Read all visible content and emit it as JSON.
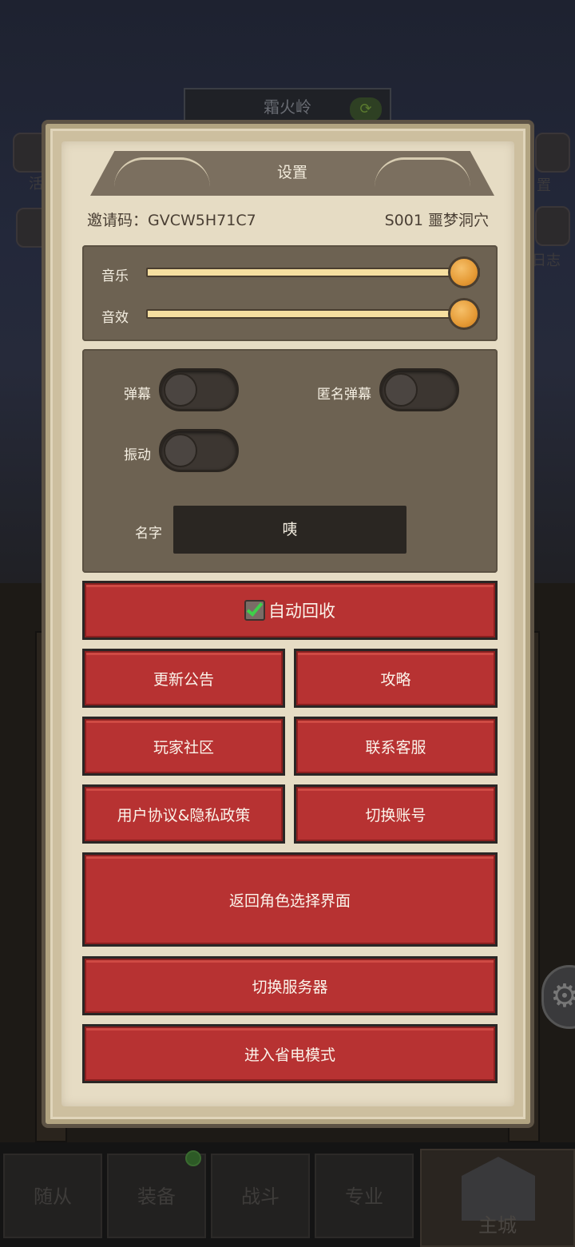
{
  "background": {
    "location_tab": "霜火岭",
    "refresh_icon": "refresh-icon",
    "side_labels": [
      "活",
      "置",
      "日志"
    ]
  },
  "bottom_nav": {
    "tabs": [
      "随从",
      "装备",
      "战斗",
      "专业"
    ],
    "main_tab": "主城"
  },
  "settings": {
    "title": "设置",
    "invite_code_label": "邀请码：",
    "invite_code": "GVCW5H71C7",
    "server": "S001 噩梦洞穴",
    "sliders": {
      "music_label": "音乐",
      "music_level": 1.0,
      "sfx_label": "音效",
      "sfx_level": 1.0
    },
    "toggles": {
      "danmaku_label": "弹幕",
      "danmaku_on": false,
      "anon_danmaku_label": "匿名弹幕",
      "anon_danmaku_on": false,
      "vibration_label": "振动",
      "vibration_on": false
    },
    "name_label": "名字",
    "name_value": "咦",
    "auto_recycle": {
      "label": "自动回收",
      "checked": true
    },
    "buttons": {
      "announcement": "更新公告",
      "guide": "攻略",
      "community": "玩家社区",
      "support": "联系客服",
      "privacy": "用户协议&隐私政策",
      "switch_account": "切换账号",
      "back_to_character": "返回角色选择界面",
      "switch_server": "切换服务器",
      "power_save": "进入省电模式"
    }
  },
  "colors": {
    "panel_parchment": "#e6dcc4",
    "panel_box": "#6d6252",
    "button_red": "#b73232",
    "slider_knob": "#e59a35",
    "check_green": "#3fd04a"
  }
}
